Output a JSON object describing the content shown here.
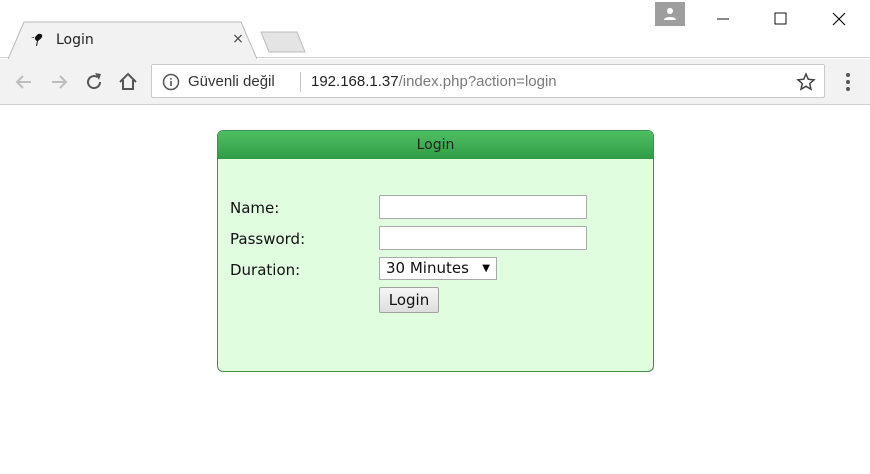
{
  "browser": {
    "tab": {
      "title": "Login",
      "close_glyph": "×",
      "favicon": "bird-favicon-icon"
    },
    "window_controls": [
      "minimize-icon",
      "maximize-icon",
      "close-icon"
    ],
    "toolbar": {
      "back_icon": "back-arrow-icon",
      "forward_icon": "forward-arrow-icon",
      "reload_icon": "reload-icon",
      "home_icon": "home-icon",
      "security_label": "Güvenli değil",
      "url_host": "192.168.1.37",
      "url_path": "/index.php?action=login",
      "bookmark_icon": "star-icon",
      "menu_icon": "kebab-menu-icon"
    }
  },
  "login": {
    "header": "Login",
    "fields": {
      "name_label": "Name:",
      "name_value": "",
      "password_label": "Password:",
      "password_value": "",
      "duration_label": "Duration:",
      "duration_selected": "30 Minutes"
    },
    "submit_label": "Login"
  },
  "colors": {
    "header_green": "#3aa84f",
    "panel_bg": "#e0fde0",
    "border_green": "#3f8f50"
  }
}
